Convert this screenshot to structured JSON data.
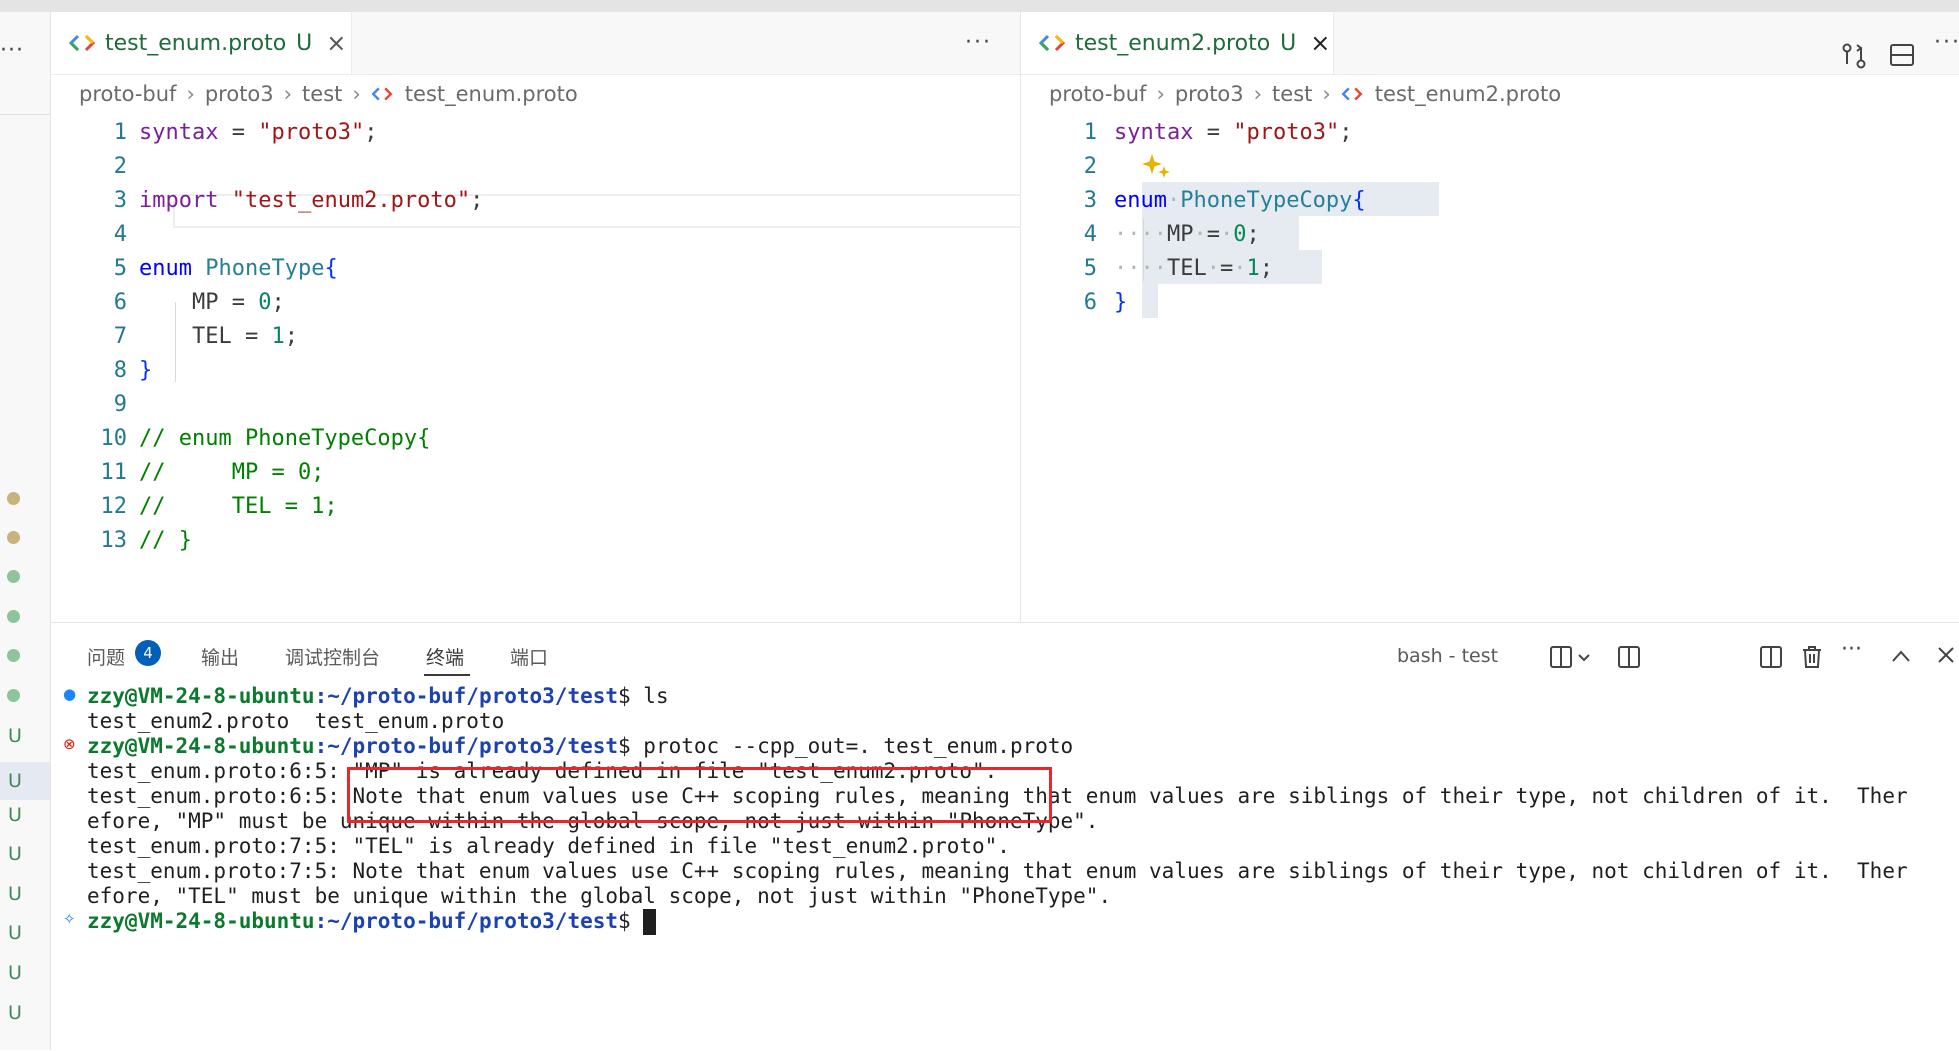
{
  "left_strip": {
    "menu_dots": "···",
    "git_markers": [
      "U",
      "U",
      "U",
      "U",
      "U",
      "U",
      "U",
      "U"
    ]
  },
  "editor_left": {
    "tab": {
      "title": "test_enum.proto",
      "status": "U",
      "close": "×"
    },
    "more": "···",
    "breadcrumb": [
      "proto-buf",
      "proto3",
      "test",
      "test_enum.proto"
    ],
    "lines": [
      {
        "n": "1",
        "parts": [
          [
            "kw2",
            "syntax"
          ],
          [
            "p",
            " = "
          ],
          [
            "str",
            "\"proto3\""
          ],
          [
            "p",
            ";"
          ]
        ]
      },
      {
        "n": "2",
        "parts": []
      },
      {
        "n": "3",
        "parts": [
          [
            "kw2",
            "import"
          ],
          [
            "p",
            " "
          ],
          [
            "str",
            "\"test_enum2.proto\""
          ],
          [
            "p",
            ";"
          ]
        ]
      },
      {
        "n": "4",
        "parts": []
      },
      {
        "n": "5",
        "parts": [
          [
            "kw",
            "enum"
          ],
          [
            "p",
            " "
          ],
          [
            "type",
            "PhoneType"
          ],
          [
            "brace",
            "{"
          ]
        ]
      },
      {
        "n": "6",
        "parts": [
          [
            "p",
            "    MP = "
          ],
          [
            "num",
            "0"
          ],
          [
            "p",
            ";"
          ]
        ]
      },
      {
        "n": "7",
        "parts": [
          [
            "p",
            "    TEL = "
          ],
          [
            "num",
            "1"
          ],
          [
            "p",
            ";"
          ]
        ]
      },
      {
        "n": "8",
        "parts": [
          [
            "brace",
            "}"
          ]
        ]
      },
      {
        "n": "9",
        "parts": []
      },
      {
        "n": "10",
        "parts": [
          [
            "cmt",
            "// enum PhoneTypeCopy{"
          ]
        ]
      },
      {
        "n": "11",
        "parts": [
          [
            "cmt",
            "//     MP = 0;"
          ]
        ]
      },
      {
        "n": "12",
        "parts": [
          [
            "cmt",
            "//     TEL = 1;"
          ]
        ]
      },
      {
        "n": "13",
        "parts": [
          [
            "cmt",
            "// }"
          ]
        ]
      }
    ]
  },
  "editor_right": {
    "tab": {
      "title": "test_enum2.proto",
      "status": "U",
      "close": "×"
    },
    "more": "···",
    "breadcrumb": [
      "proto-buf",
      "proto3",
      "test",
      "test_enum2.proto"
    ],
    "lines": [
      {
        "n": "1",
        "parts": [
          [
            "kw2",
            "syntax"
          ],
          [
            "p",
            " = "
          ],
          [
            "str",
            "\"proto3\""
          ],
          [
            "p",
            ";"
          ]
        ]
      },
      {
        "n": "2",
        "parts": []
      },
      {
        "n": "3",
        "parts": [
          [
            "kw",
            "enum"
          ],
          [
            "ws",
            "·"
          ],
          [
            "type",
            "PhoneTypeCopy"
          ],
          [
            "brace",
            "{"
          ]
        ]
      },
      {
        "n": "4",
        "parts": [
          [
            "ws",
            "····"
          ],
          [
            "p",
            "MP"
          ],
          [
            "ws",
            "·"
          ],
          [
            "p",
            "="
          ],
          [
            "ws",
            "·"
          ],
          [
            "num",
            "0"
          ],
          [
            "p",
            ";"
          ]
        ]
      },
      {
        "n": "5",
        "parts": [
          [
            "ws",
            "····"
          ],
          [
            "p",
            "TEL"
          ],
          [
            "ws",
            "·"
          ],
          [
            "p",
            "="
          ],
          [
            "ws",
            "·"
          ],
          [
            "num",
            "1"
          ],
          [
            "p",
            ";"
          ]
        ]
      },
      {
        "n": "6",
        "parts": [
          [
            "brace",
            "}"
          ]
        ]
      }
    ]
  },
  "panel": {
    "tabs": [
      "问题",
      "输出",
      "调试控制台",
      "终端",
      "端口"
    ],
    "problems_count": "4",
    "active_tab": "终端",
    "terminal_name": "bash - test",
    "more": "···"
  },
  "terminal": {
    "lines": [
      {
        "mark": "●",
        "user": "zzy@VM-24-8-ubuntu",
        "path": ":~/proto-buf/proto3/test",
        "cmd": "$ ls"
      },
      {
        "text": "test_enum2.proto  test_enum.proto"
      },
      {
        "mark": "⊗",
        "user": "zzy@VM-24-8-ubuntu",
        "path": ":~/proto-buf/proto3/test",
        "cmd": "$ protoc --cpp_out=. test_enum.proto"
      },
      {
        "text": "test_enum.proto:6:5: \"MP\" is already defined in file \"test_enum2.proto\"."
      },
      {
        "text": "test_enum.proto:6:5: Note that enum values use C++ scoping rules, meaning that enum values are siblings of their type, not children of it.  Ther"
      },
      {
        "text": "efore, \"MP\" must be unique within the global scope, not just within \"PhoneType\"."
      },
      {
        "text": "test_enum.proto:7:5: \"TEL\" is already defined in file \"test_enum2.proto\"."
      },
      {
        "text": "test_enum.proto:7:5: Note that enum values use C++ scoping rules, meaning that enum values are siblings of their type, not children of it.  Ther"
      },
      {
        "text": "efore, \"TEL\" must be unique within the global scope, not just within \"PhoneType\"."
      },
      {
        "mark": "✧",
        "user": "zzy@VM-24-8-ubuntu",
        "path": ":~/proto-buf/proto3/test",
        "cmd": "$ ",
        "cursor": true
      }
    ]
  },
  "colors": {
    "accent_blue": "#005fb8",
    "git_untracked_green": "#3e8a5a",
    "highlight_red": "#e8262b"
  }
}
